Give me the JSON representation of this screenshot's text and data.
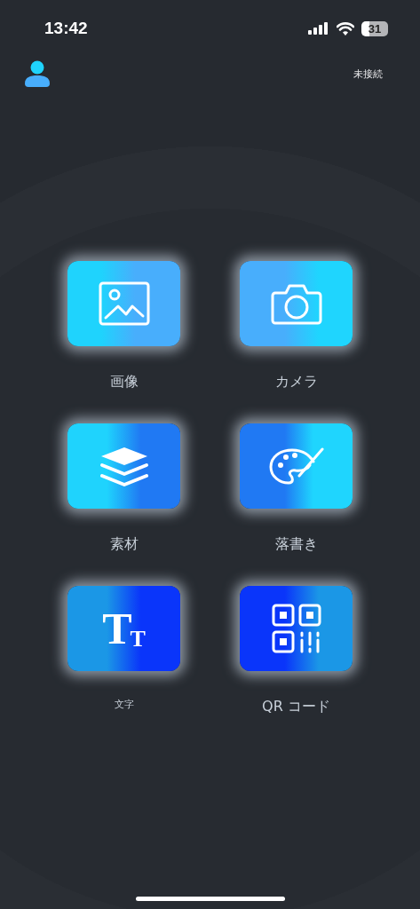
{
  "status_bar": {
    "time": "13:42",
    "battery": "31"
  },
  "header": {
    "connection_status": "未接続"
  },
  "tiles": [
    {
      "kind": "image",
      "label": "画像",
      "small_label": false
    },
    {
      "kind": "camera",
      "label": "カメラ",
      "small_label": false
    },
    {
      "kind": "layers",
      "label": "素材",
      "small_label": false
    },
    {
      "kind": "palette",
      "label": "落書き",
      "small_label": false
    },
    {
      "kind": "text",
      "label": "文字",
      "small_label": true,
      "glyph": [
        "T",
        "T"
      ]
    },
    {
      "kind": "qr",
      "label": "QR コード",
      "small_label": false
    }
  ]
}
